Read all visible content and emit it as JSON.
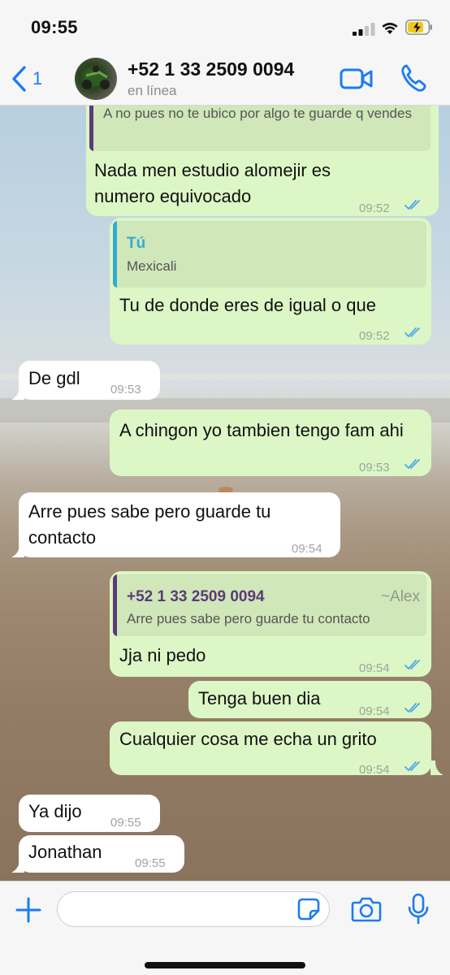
{
  "status_bar": {
    "time": "09:55"
  },
  "header": {
    "back_count": "1",
    "contact_name": "+52 1 33 2509 0094",
    "contact_status": "en línea"
  },
  "messages": [
    {
      "dir": "out",
      "quote": {
        "text": "A no pues no te ubico por algo te guarde q vendes"
      },
      "text": "Nada men estudio alomejir es numero equivocado",
      "time": "09:52",
      "read": true
    },
    {
      "dir": "out",
      "quote": {
        "name": "Tú",
        "text": "Mexicali"
      },
      "text": "Tu de donde eres de igual o que",
      "time": "09:52",
      "read": true
    },
    {
      "dir": "in",
      "text": "De gdl",
      "time": "09:53"
    },
    {
      "dir": "out",
      "text": "A chingon yo tambien tengo fam ahi",
      "time": "09:53",
      "read": true
    },
    {
      "dir": "in",
      "text": "Arre pues sabe pero guarde tu contacto",
      "time": "09:54"
    },
    {
      "dir": "out",
      "quote": {
        "name": "+52 1 33 2509 0094",
        "alias": "~Alex",
        "text": "Arre pues sabe pero guarde tu contacto"
      },
      "text": "Jja ni pedo",
      "time": "09:54",
      "read": true
    },
    {
      "dir": "out",
      "text": "Tenga buen dia",
      "time": "09:54",
      "read": true
    },
    {
      "dir": "out",
      "text": "Cualquier cosa me echa un grito",
      "time": "09:54",
      "read": true
    },
    {
      "dir": "in",
      "text": "Ya dijo",
      "time": "09:55"
    },
    {
      "dir": "in",
      "text": "Jonathan",
      "time": "09:55"
    }
  ],
  "input": {
    "placeholder": ""
  },
  "colors": {
    "accent": "#1b7cf2",
    "outgoing_bubble": "#dcf7c5",
    "incoming_bubble": "#ffffff",
    "read_ticks": "#4fa6ea",
    "quote_self": "#35aad1",
    "quote_other": "#5d3a78"
  },
  "icons": [
    "back-chevron-icon",
    "video-call-icon",
    "phone-icon",
    "plus-icon",
    "sticker-icon",
    "camera-icon",
    "microphone-icon"
  ]
}
